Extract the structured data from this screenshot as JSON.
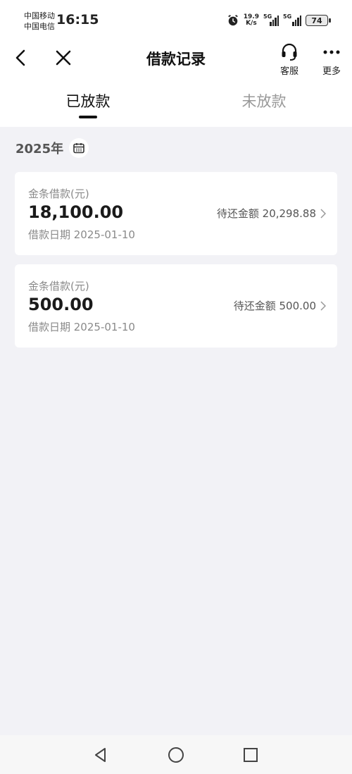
{
  "status_bar": {
    "carrier_1": "中国移动",
    "carrier_2": "中国电信",
    "time": "16:15",
    "net_speed_value": "19.9",
    "net_speed_unit": "K/s",
    "signal_1_label": "5G",
    "signal_2_label": "5G",
    "battery": "74"
  },
  "nav": {
    "title": "借款记录",
    "service_label": "客服",
    "more_label": "更多"
  },
  "tabs": [
    {
      "label": "已放款",
      "active": true
    },
    {
      "label": "未放款",
      "active": false
    }
  ],
  "year_filter": {
    "year": "2025年"
  },
  "records": [
    {
      "title": "金条借款(元)",
      "amount": "18,100.00",
      "date": "借款日期 2025-01-10",
      "remaining": "待还金额 20,298.88"
    },
    {
      "title": "金条借款(元)",
      "amount": "500.00",
      "date": "借款日期 2025-01-10",
      "remaining": "待还金额 500.00"
    }
  ],
  "icons": {
    "back": "chevron-left-icon",
    "close": "close-icon",
    "service": "headset-icon",
    "more": "more-dots-icon",
    "calendar": "calendar-icon",
    "sys_back": "triangle-back-icon",
    "sys_home": "circle-home-icon",
    "sys_recent": "square-recent-icon"
  }
}
